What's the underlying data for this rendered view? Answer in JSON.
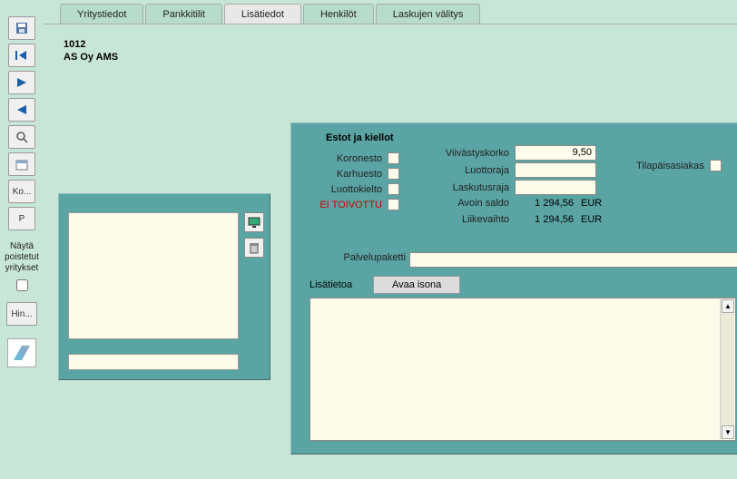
{
  "tabs": {
    "yritystiedot": "Yritystiedot",
    "pankkitilit": "Pankkitilit",
    "lisatiedot": "Lisätiedot",
    "henkilot": "Henkilöt",
    "laskujen_valitys": "Laskujen välitys"
  },
  "company": {
    "code": "1012",
    "name": "AS Oy AMS"
  },
  "left_toolbar": {
    "ko_label": "Ko...",
    "p_label": "P",
    "show_deleted_label": "Näytä poistetut yritykset",
    "hin_label": "Hin..."
  },
  "panel": {
    "section_title": "Estot ja kiellot",
    "koronesto": "Koronesto",
    "karhuesto": "Karhuesto",
    "luottokielto": "Luottokielto",
    "ei_toivottu": "EI TOIVOTTU",
    "viivastyskorko_label": "Viivästyskorko",
    "viivastyskorko_value": "9,50",
    "luottoraja_label": "Luottoraja",
    "luottoraja_value": "",
    "laskutusraja_label": "Laskutusraja",
    "laskutusraja_value": "",
    "avoin_saldo_label": "Avoin saldo",
    "avoin_saldo_value": "1 294,56",
    "liikevaihto_label": "Liikevaihto",
    "liikevaihto_value": "1 294,56",
    "currency": "EUR",
    "tilapaisasiakas_label": "Tilapäisasiakas",
    "palvelupaketti_label": "Palvelupaketti",
    "lisatietoa_label": "Lisätietoa",
    "avaa_isona_button": "Avaa isona"
  }
}
